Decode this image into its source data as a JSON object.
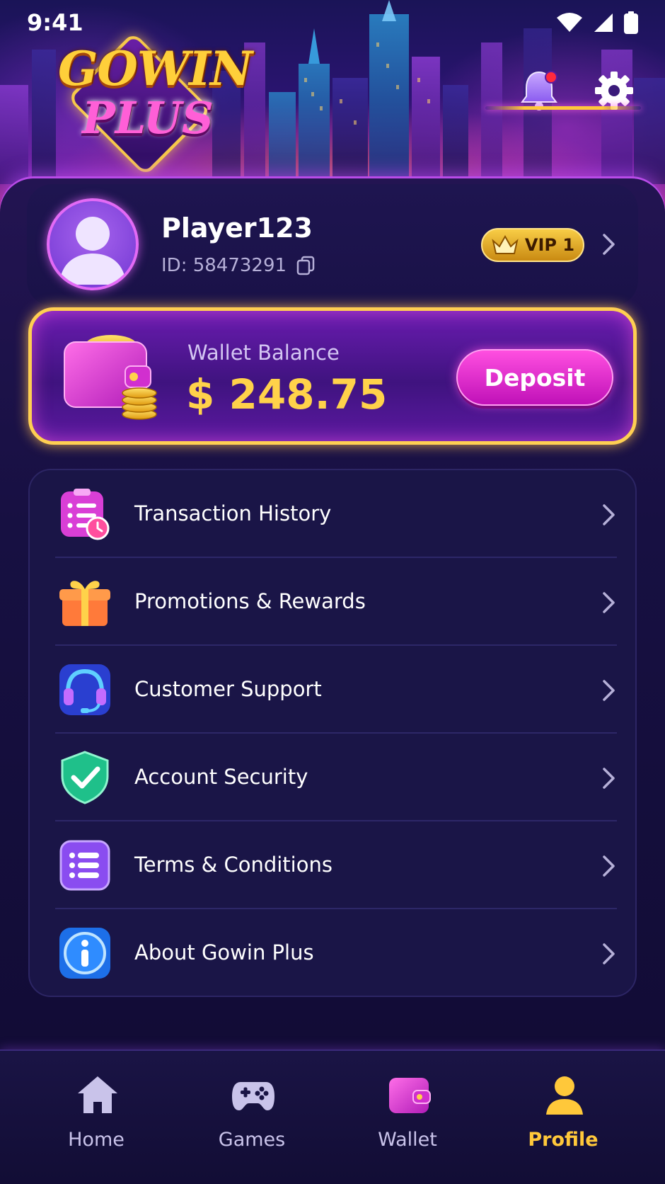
{
  "status_bar": {
    "time": "9:41"
  },
  "brand": {
    "logo_line1": "GOWIN",
    "logo_line2": "PLUS"
  },
  "header": {
    "has_notification": true
  },
  "profile": {
    "username": "Player123",
    "id_text": "ID: 58473291",
    "vip_label": "VIP 1"
  },
  "wallet": {
    "label": "Wallet Balance",
    "amount": "$ 248.75",
    "deposit_label": "Deposit"
  },
  "menu": {
    "items": [
      {
        "label": "Transaction History",
        "icon": "transaction-history-icon"
      },
      {
        "label": "Promotions & Rewards",
        "icon": "gift-icon"
      },
      {
        "label": "Customer Support",
        "icon": "headset-icon"
      },
      {
        "label": "Account Security",
        "icon": "shield-check-icon"
      },
      {
        "label": "Terms & Conditions",
        "icon": "document-list-icon"
      },
      {
        "label": "About Gowin Plus",
        "icon": "info-icon"
      }
    ]
  },
  "bottom_nav": {
    "active": "Profile",
    "items": [
      {
        "label": "Home",
        "icon": "home-icon"
      },
      {
        "label": "Games",
        "icon": "gamepad-icon"
      },
      {
        "label": "Wallet",
        "icon": "wallet-icon"
      },
      {
        "label": "Profile",
        "icon": "user-icon"
      }
    ]
  },
  "colors": {
    "background": "#120b33",
    "accent_gold": "#ffd24a",
    "accent_pink": "#ff4fe0",
    "card_purple": "#6a1cb0"
  }
}
